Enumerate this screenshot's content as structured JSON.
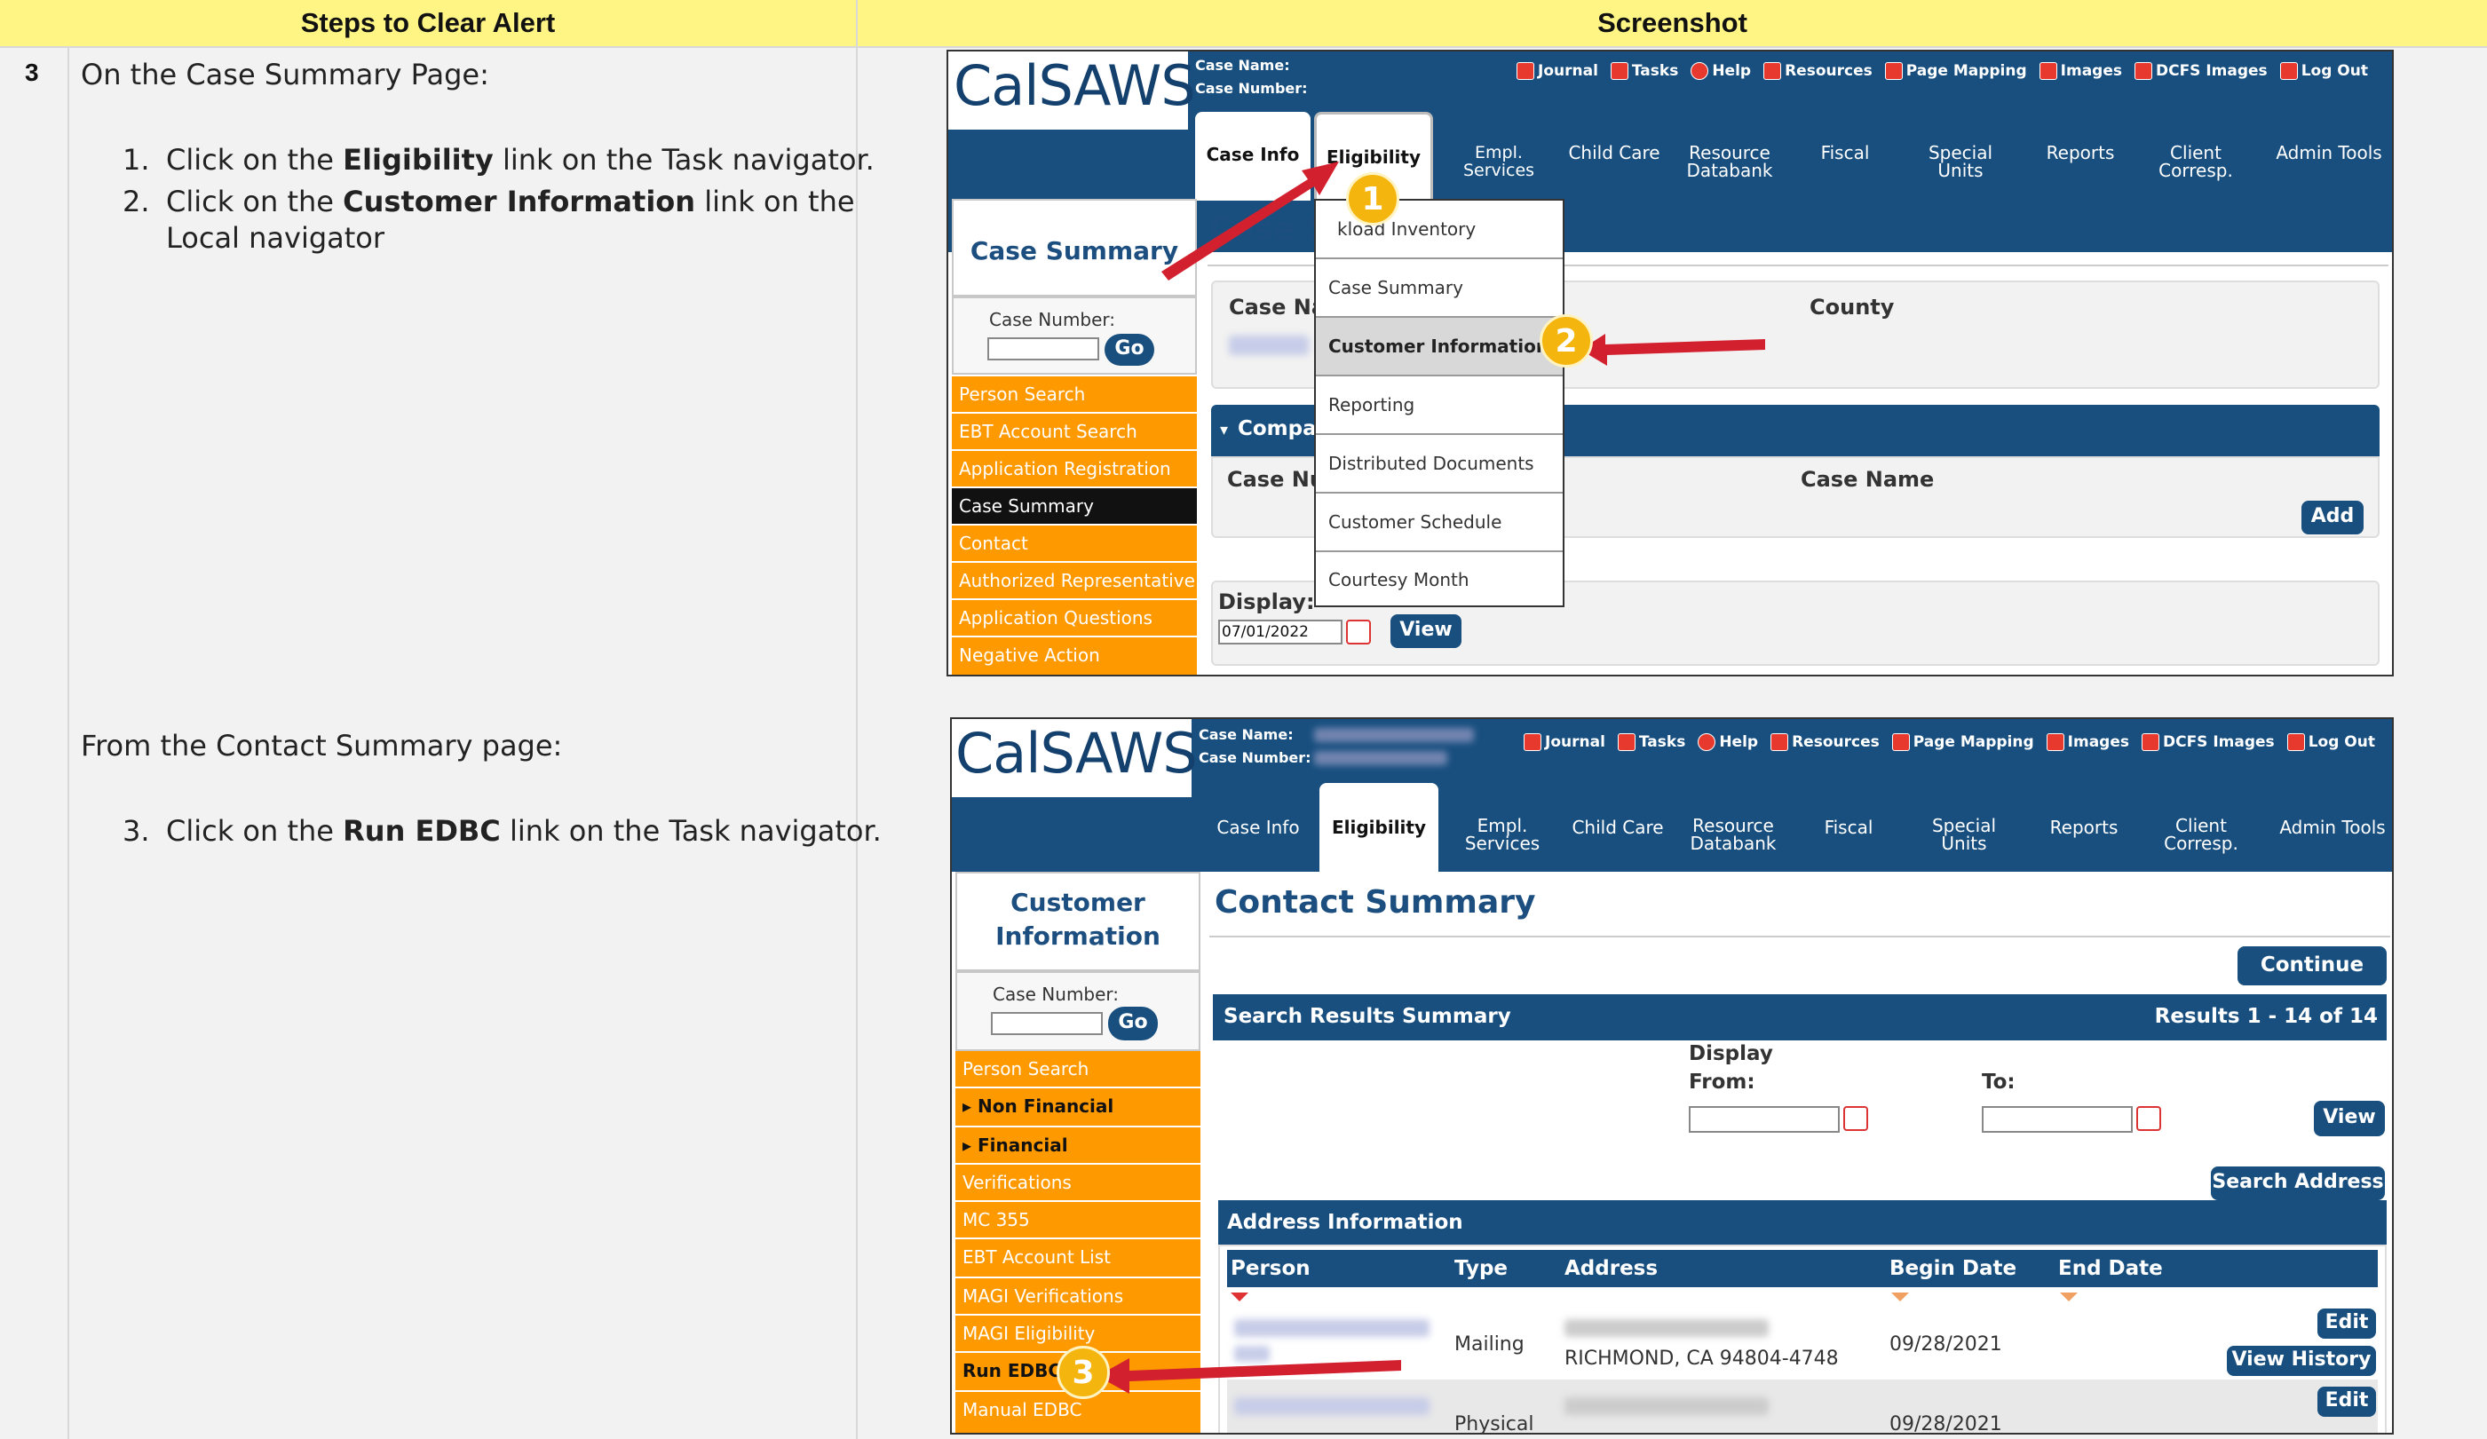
{
  "table": {
    "col1_header": "Steps to Clear Alert",
    "col2_header": "Screenshot",
    "step_number": "3",
    "intro1": "On the Case Summary Page:",
    "item1_num": "1.",
    "item1_pre": "Click on the ",
    "item1_bold": "Eligibility",
    "item1_post": " link on the Task navigator.",
    "item2_num": "2.",
    "item2_pre": "Click on the ",
    "item2_bold": "Customer Information",
    "item2_post": " link on the",
    "item2_line2": "Local navigator",
    "intro2": "From the Contact Summary page:",
    "item3_num": "3.",
    "item3_pre": "Click on the ",
    "item3_bold": "Run EDBC",
    "item3_post": " link on the Task navigator."
  },
  "app": {
    "logo": "CalSAWS",
    "case_name_label": "Case Name:",
    "case_number_label": "Case Number:",
    "utility_links": [
      "Journal",
      "Tasks",
      "Help",
      "Resources",
      "Page Mapping",
      "Images",
      "DCFS Images",
      "Log Out"
    ],
    "tabs": [
      "Case Info",
      "Eligibility",
      "Empl. Services",
      "Child Care",
      "Resource Databank",
      "Fiscal",
      "Special Units",
      "Reports",
      "Client Corresp.",
      "Admin Tools"
    ],
    "case_number_field": "Case Number:",
    "go": "Go"
  },
  "shot1": {
    "side_title": "Case Summary",
    "side_items": [
      "Person Search",
      "EBT Account Search",
      "Application Registration",
      "Case Summary",
      "Contact",
      "Authorized Representative",
      "Application Questions",
      "Negative Action"
    ],
    "page_title": "Case S",
    "case_na": "Case Na",
    "county": "County",
    "compa": "Compa",
    "case_nu": "Case Nu",
    "case_name": "Case Name",
    "add": "Add",
    "display": "Display:",
    "display_date": "07/01/2022",
    "view": "View",
    "menu_items": [
      "kload Inventory",
      "Case Summary",
      "Customer Information",
      "Reporting",
      "Distributed Documents",
      "Customer Schedule",
      "Courtesy Month"
    ],
    "badge1": "1",
    "badge2": "2"
  },
  "shot2": {
    "side_title_1": "Customer",
    "side_title_2": "Information",
    "side_items": [
      "Person Search",
      "Non Financial",
      "Financial",
      "Verifications",
      "MC 355",
      "EBT Account List",
      "MAGI Verifications",
      "MAGI Eligibility",
      "Run EDBC",
      "Manual EDBC"
    ],
    "page_title": "Contact Summary",
    "continue": "Continue",
    "search_results": "Search Results Summary",
    "results_count": "Results 1 - 14 of 14",
    "display": "Display",
    "from": "From:",
    "to": "To:",
    "view": "View",
    "search_address": "Search Address",
    "address_info": "Address Information",
    "col_person": "Person",
    "col_type": "Type",
    "col_address": "Address",
    "col_begin": "Begin Date",
    "col_end": "End Date",
    "row1_type": "Mailing",
    "row1_city": "RICHMOND, CA 94804-4748",
    "row1_begin": "09/28/2021",
    "row2_type": "Physical",
    "row2_begin": "09/28/2021",
    "edit": "Edit",
    "view_history": "View History",
    "badge3": "3"
  },
  "colors": {
    "header_bg": "#fff585",
    "nav_blue": "#184f7f",
    "side_orange": "#ff9900",
    "arrow_red": "#d3202f",
    "badge_gold": "#f5b50f"
  }
}
